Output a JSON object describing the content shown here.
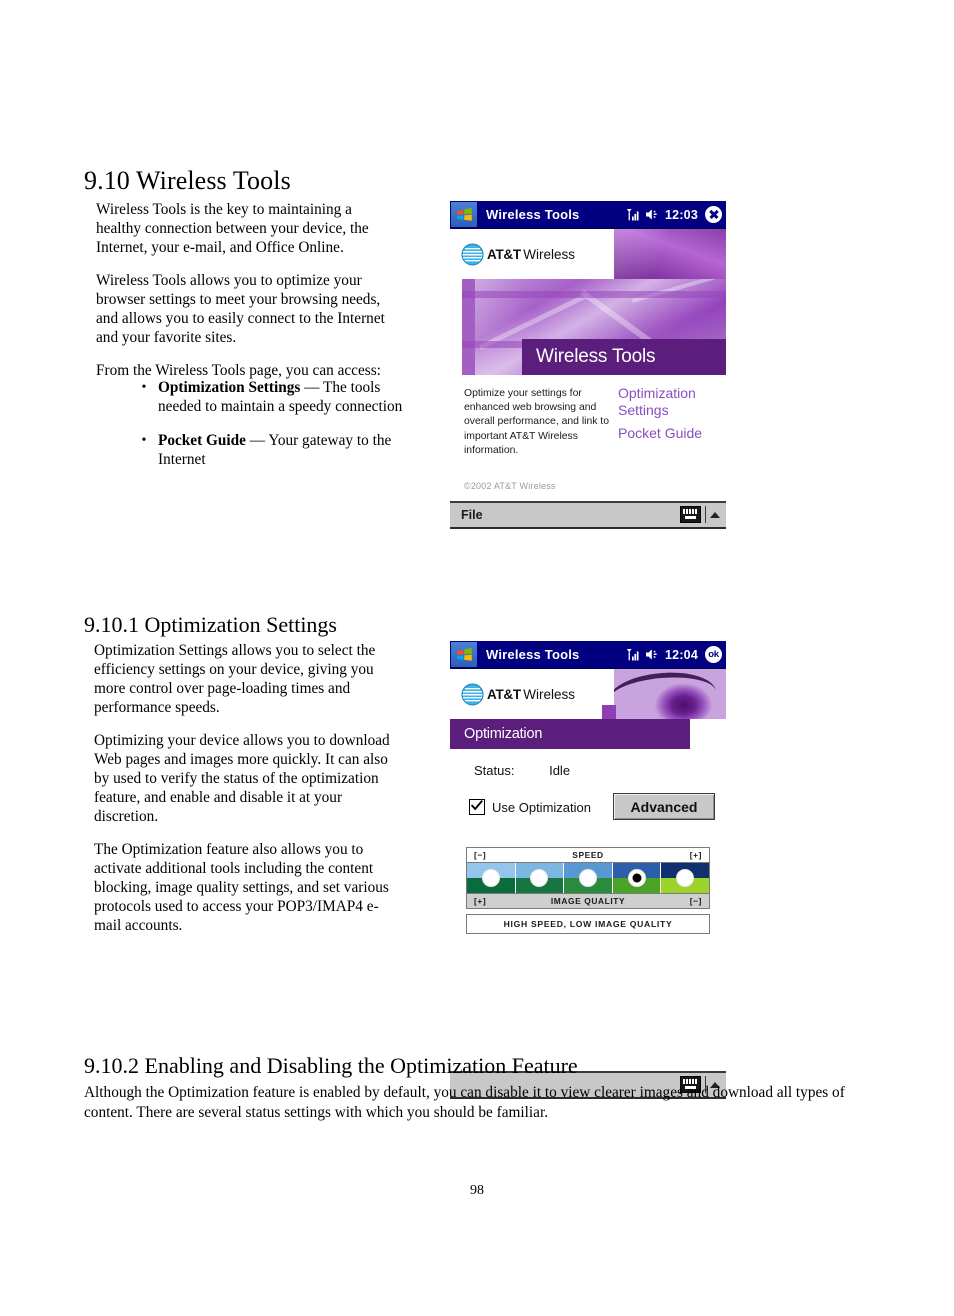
{
  "document": {
    "page_number": "98",
    "section_1": {
      "heading": "9.10 Wireless Tools",
      "paragraphs": [
        "Wireless Tools is the key to maintaining a healthy connection between your device, the Internet, your e-mail, and Office Online.",
        "Wireless Tools allows you to optimize your browser settings to meet your browsing needs, and allows you to easily connect to the Internet and your favorite sites.",
        "From the Wireless Tools page, you can access:"
      ],
      "bullets": [
        {
          "term": "Optimization Settings",
          "rest": " — The tools needed to maintain a speedy connection"
        },
        {
          "term": "Pocket Guide",
          "rest": " — Your gateway to the Internet"
        }
      ]
    },
    "section_2": {
      "heading": "9.10.1  Optimization Settings",
      "paragraphs": [
        "Optimization Settings allows you to select the efficiency settings on your device, giving you more control over page-loading times and performance speeds.",
        "Optimizing your device allows you to download Web pages and images more quickly. It can also by used to verify the status of the optimization feature, and enable and disable it at your discretion.",
        "The Optimization feature also allows you to activate additional tools including the content blocking, image quality settings, and set various protocols used to access your POP3/IMAP4 e-mail accounts."
      ]
    },
    "section_3": {
      "heading": "9.10.2  Enabling and Disabling the Optimization Feature",
      "paragraph": "Although the Optimization feature is enabled by default, you can disable it to view clearer images and download all types of content. There are several status settings with which you should be familiar."
    }
  },
  "screenshot_1": {
    "titlebar": {
      "start_icon": "windows-flag-icon",
      "title": "Wireless Tools",
      "signal_icon": "signal-strength-icon",
      "speaker_icon": "speaker-volume-icon",
      "time": "12:03",
      "close_label": "x"
    },
    "brand": {
      "logo_icon": "att-globe-icon",
      "name_bold": "AT&T",
      "name_light": "Wireless"
    },
    "banner_caption": "Wireless Tools",
    "blurb": "Optimize your settings for enhanced web browsing and overall performance, and link to important AT&T Wireless information.",
    "links": [
      "Optimization Settings",
      "Pocket Guide"
    ],
    "copyright": "©2002 AT&T Wireless",
    "commandbar": {
      "menu_label": "File",
      "keyboard_icon": "soft-keyboard-icon",
      "caret_icon": "up-caret-icon"
    }
  },
  "screenshot_2": {
    "titlebar": {
      "start_icon": "windows-flag-icon",
      "title": "Wireless Tools",
      "signal_icon": "signal-strength-icon",
      "speaker_icon": "speaker-volume-icon",
      "time": "12:04",
      "ok_label": "ok"
    },
    "brand": {
      "logo_icon": "att-globe-icon",
      "name_bold": "AT&T",
      "name_light": "Wireless"
    },
    "banner_caption": "Optimization",
    "status": {
      "label": "Status:",
      "value": "Idle"
    },
    "checkbox": {
      "label": "Use Optimization",
      "checked": true
    },
    "advanced_button": "Advanced",
    "slider": {
      "top_minus": "[−]",
      "top_label": "SPEED",
      "top_plus": "[+]",
      "bottom_plus": "[+]",
      "bottom_label": "IMAGE QUALITY",
      "bottom_minus": "[−]",
      "summary": "HIGH SPEED, LOW IMAGE QUALITY",
      "steps": 5,
      "selected_index": 3
    },
    "commandbar": {
      "menu_label": "",
      "keyboard_icon": "soft-keyboard-icon",
      "caret_icon": "up-caret-icon"
    }
  },
  "colors": {
    "titlebar_blue": "#000080",
    "banner_purple": "#5c1e7d",
    "link_purple": "#8a4fbe",
    "commandbar_grey": "#c8c8c8"
  }
}
